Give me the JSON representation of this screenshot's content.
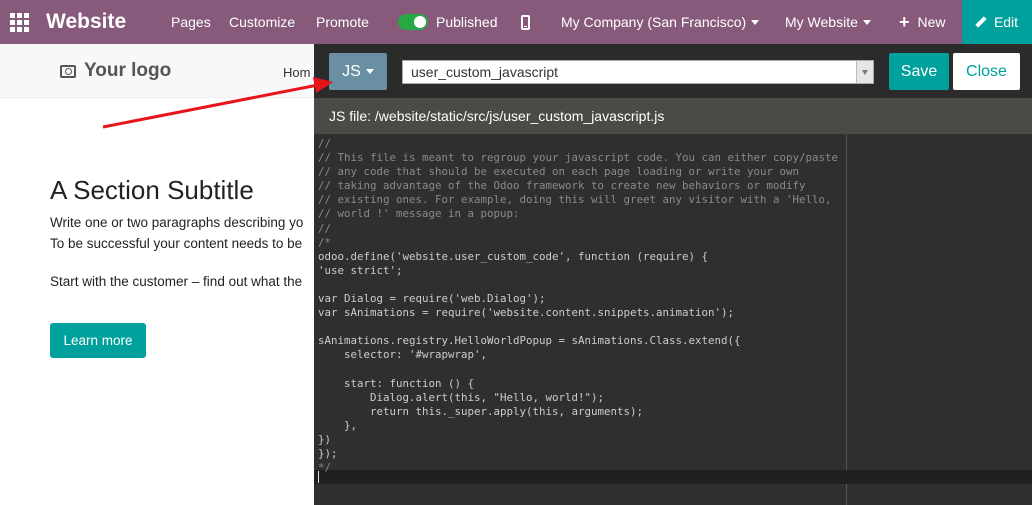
{
  "navbar": {
    "brand": "Website",
    "pages": "Pages",
    "customize": "Customize",
    "promote": "Promote",
    "published": "Published",
    "company": "My Company (San Francisco)",
    "my_website": "My Website",
    "new": "New",
    "edit": "Edit",
    "colors": {
      "bar": "#875a7b",
      "accent": "#00a09d",
      "toggle_on": "#28a745"
    }
  },
  "site": {
    "logo": "Your logo",
    "home_link": "Hom",
    "subtitle": "A Section Subtitle",
    "para1": "Write one or two paragraphs describing yo",
    "para2": "To be successful your content needs to be",
    "para3": "Start with the customer – find out what the",
    "learn_more": "Learn more"
  },
  "editor": {
    "mode": "JS",
    "file_select": "user_custom_javascript",
    "save": "Save",
    "close": "Close",
    "file_path": "JS file: /website/static/src/js/user_custom_javascript.js",
    "code_lines": [
      "//",
      "// This file is meant to regroup your javascript code. You can either copy/paste",
      "// any code that should be executed on each page loading or write your own",
      "// taking advantage of the Odoo framework to create new behaviors or modify",
      "// existing ones. For example, doing this will greet any visitor with a 'Hello,",
      "// world !' message in a popup:",
      "//",
      "/*",
      "odoo.define('website.user_custom_code', function (require) {",
      "'use strict';",
      "",
      "var Dialog = require('web.Dialog');",
      "var sAnimations = require('website.content.snippets.animation');",
      "",
      "sAnimations.registry.HelloWorldPopup = sAnimations.Class.extend({",
      "    selector: '#wrapwrap',",
      "",
      "    start: function () {",
      "        Dialog.alert(this, \"Hello, world!\");",
      "        return this._super.apply(this, arguments);",
      "    },",
      "})",
      "});",
      "*/"
    ]
  }
}
